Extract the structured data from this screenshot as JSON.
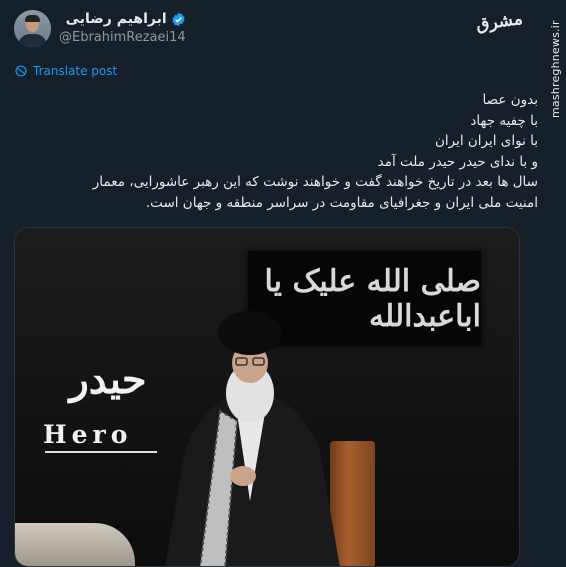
{
  "author": {
    "display_name": "ابراهیم رضایی",
    "handle": "@EbrahimRezaei14"
  },
  "translate_label": "Translate post",
  "brand": {
    "logo": "مشرق",
    "url": "mashreghnews.ir"
  },
  "post": {
    "lines": [
      "بدون عصا",
      "با چفیه جهاد",
      "با نوای ایران ایران",
      "و با ندای حیدر حیدر ملت آمد",
      "سال ها بعد در تاریخ خواهند گفت و خواهند نوشت که این رهبر عاشورایی، معمار",
      "امنیت ملی ایران و جغرافیای مقاومت در سراسر منطقه و جهان است."
    ]
  },
  "media": {
    "banner_text": "صلی الله علیک یا اباعبدالله",
    "overlay_arabic": "حیدر",
    "overlay_word": "Hero"
  },
  "colors": {
    "background": "#15202b",
    "link": "#1d9bf0",
    "verified": "#1d9bf0"
  }
}
